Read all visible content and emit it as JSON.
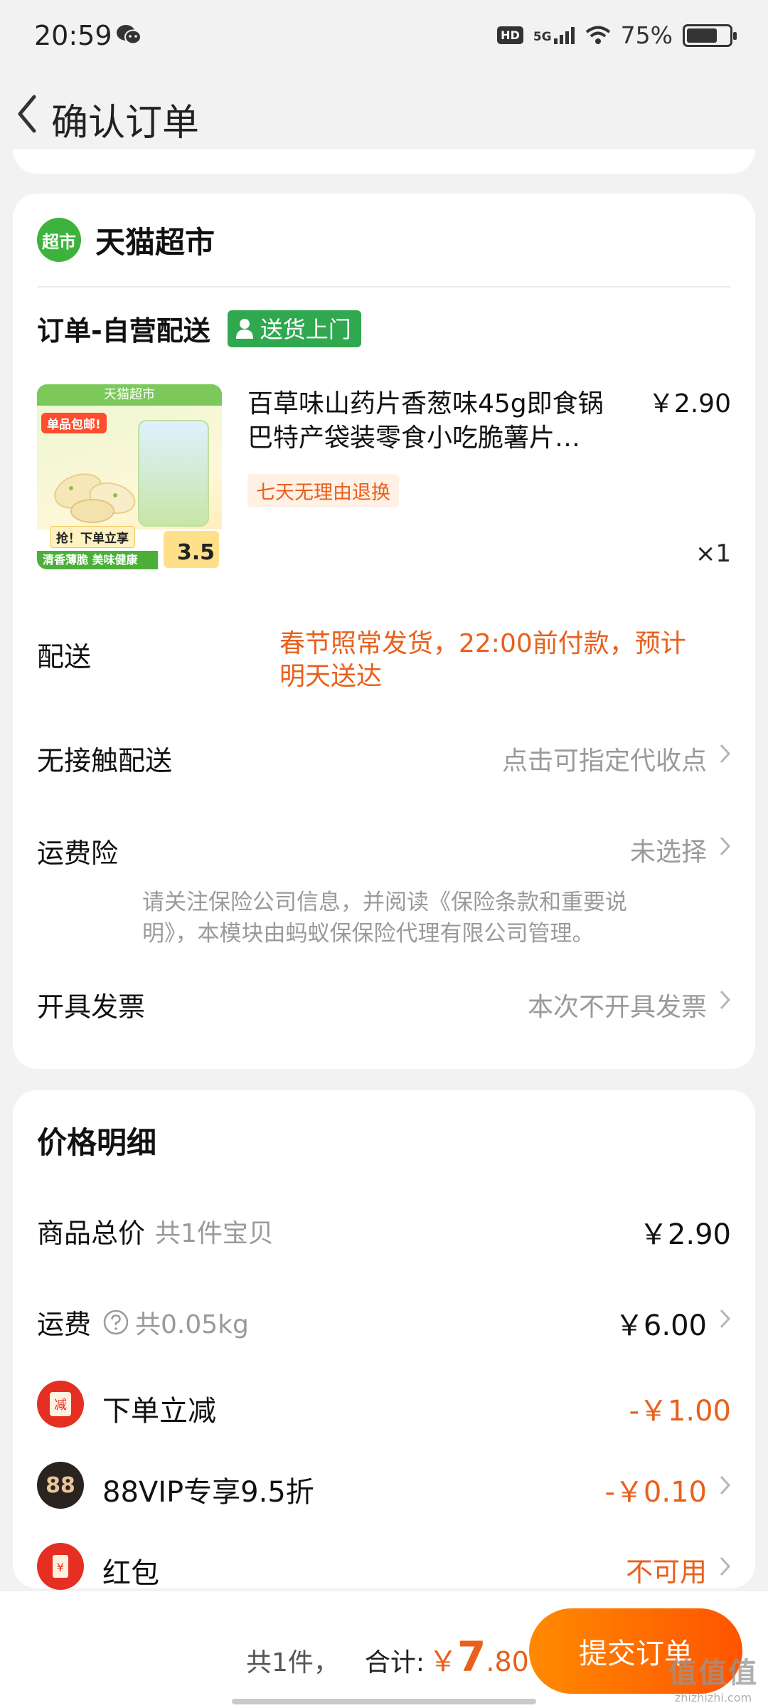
{
  "status_bar": {
    "time": "20:59",
    "hd": "HD",
    "network": "5G",
    "battery": "75%",
    "battery_level": 0.75
  },
  "nav": {
    "title": "确认订单"
  },
  "store": {
    "logo_text": "超市",
    "name": "天猫超市"
  },
  "order": {
    "type": "订单-自营配送",
    "badge": "送货上门"
  },
  "product": {
    "image_banner": "天猫超市",
    "image_tag": "单品包邮!",
    "image_cta": "抢！下单立享",
    "image_slogan": "清香薄脆 美味健康",
    "image_price": "3.5",
    "title_line1": "百草味山药片香葱味45g即食锅",
    "title_line2": "巴特产袋装零食小吃脆薯片…",
    "price": "￥2.90",
    "return_tag": "七天无理由退换",
    "qty": "×1"
  },
  "rows": {
    "shipping_label": "配送",
    "shipping_value_line1": "春节照常发货，22:00前付款，预计",
    "shipping_value_line2": "明天送达",
    "contactless_label": "无接触配送",
    "contactless_value": "点击可指定代收点",
    "insurance_label": "运费险",
    "insurance_value": "未选择",
    "insurance_note_line1": "请关注保险公司信息，并阅读《保险条款和重要说",
    "insurance_note_line2": "明》，本模块由蚂蚁保保险代理有限公司管理。",
    "invoice_label": "开具发票",
    "invoice_value": "本次不开具发票"
  },
  "price_detail": {
    "title": "价格明细",
    "goods_label": "商品总价",
    "goods_count": "共1件宝贝",
    "goods_value": "￥2.90",
    "freight_label": "运费",
    "freight_weight": "共0.05kg",
    "freight_value": "￥6.00",
    "discount1_icon": "减",
    "discount1_label": "下单立减",
    "discount1_value": "-￥1.00",
    "discount2_icon": "88",
    "discount2_label": "88VIP专享9.5折",
    "discount2_value": "-￥0.10",
    "redpacket_icon": "¥",
    "redpacket_label": "红包",
    "redpacket_value": "不可用"
  },
  "footer": {
    "count": "共1件，",
    "total_label": "合计:",
    "currency": "￥",
    "total_int": "7",
    "total_dec": ".80",
    "submit": "提交订单"
  },
  "watermark": {
    "main": "值值值",
    "sub": "zhizhizhi.com"
  },
  "colors": {
    "accent": "#e8601c",
    "button": "#ff6a00",
    "green": "#2fa84f"
  }
}
